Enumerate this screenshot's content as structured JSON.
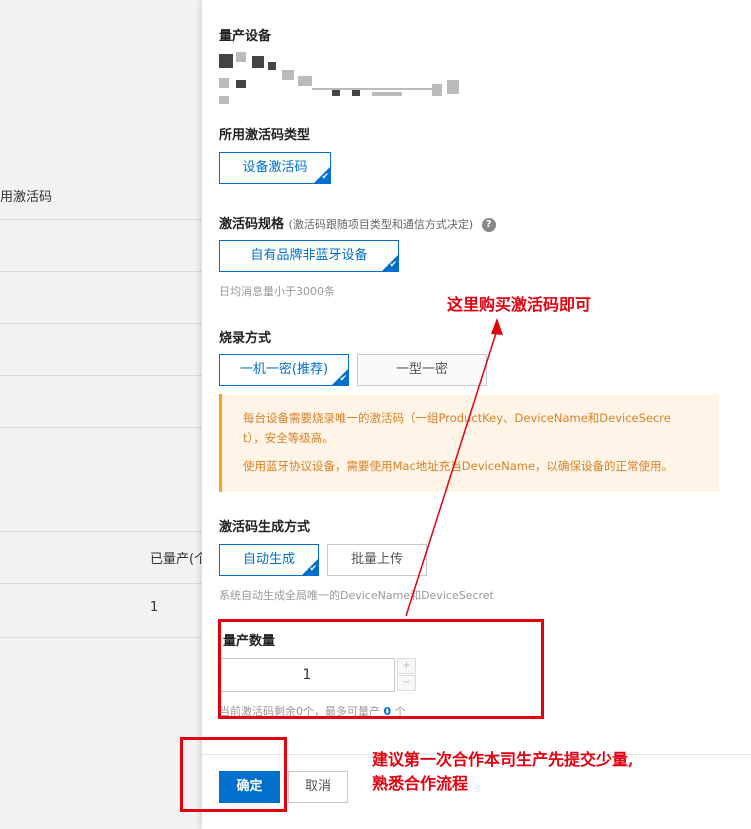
{
  "background": {
    "rows": [
      {
        "text": "用激活码"
      },
      {
        "text": ""
      },
      {
        "text": ""
      },
      {
        "text": ""
      }
    ],
    "column_header": "已量产(个",
    "column_value": "1"
  },
  "panel": {
    "product_label": "量产设备",
    "code_type": {
      "label": "所用激活码类型",
      "option": "设备激活码"
    },
    "code_spec": {
      "label": "激活码规格",
      "note": "(激活码跟随项目类型和通信方式决定)",
      "help": "?",
      "option": "自有品牌非蓝牙设备",
      "hint": "日均消息量小于3000条"
    },
    "burn_mode": {
      "label": "烧录方式",
      "options": [
        "一机一密(推荐)",
        "一型一密"
      ],
      "notice_lines": [
        "每台设备需要烧录唯一的激活码（一组ProductKey、DeviceName和DeviceSecre",
        "t），安全等级高。",
        "使用蓝牙协议设备，需要使用Mac地址充当DeviceName，以确保设备的正常使用。"
      ]
    },
    "generation": {
      "label": "激活码生成方式",
      "options": [
        "自动生成",
        "批量上传"
      ],
      "hint": "系统自动生成全局唯一的DeviceName和DeviceSecret"
    },
    "quantity": {
      "label": "量产数量",
      "value": "1",
      "hint_prefix": "当前激活码剩余0个，最多可量产",
      "hint_max": "0",
      "hint_suffix": "个",
      "step_up": "+",
      "step_down": "−"
    },
    "footer": {
      "confirm": "确定",
      "cancel": "取消"
    }
  },
  "annotations": {
    "buy_note": "这里购买激活码即可",
    "advice_line1": "建议第一次合作本司生产先提交少量,",
    "advice_line2": "熟悉合作流程"
  },
  "colors": {
    "primary": "#0070cc",
    "annotation_red": "#e3000f",
    "notice_bg": "#fff4e6",
    "notice_text": "#d9822b"
  }
}
